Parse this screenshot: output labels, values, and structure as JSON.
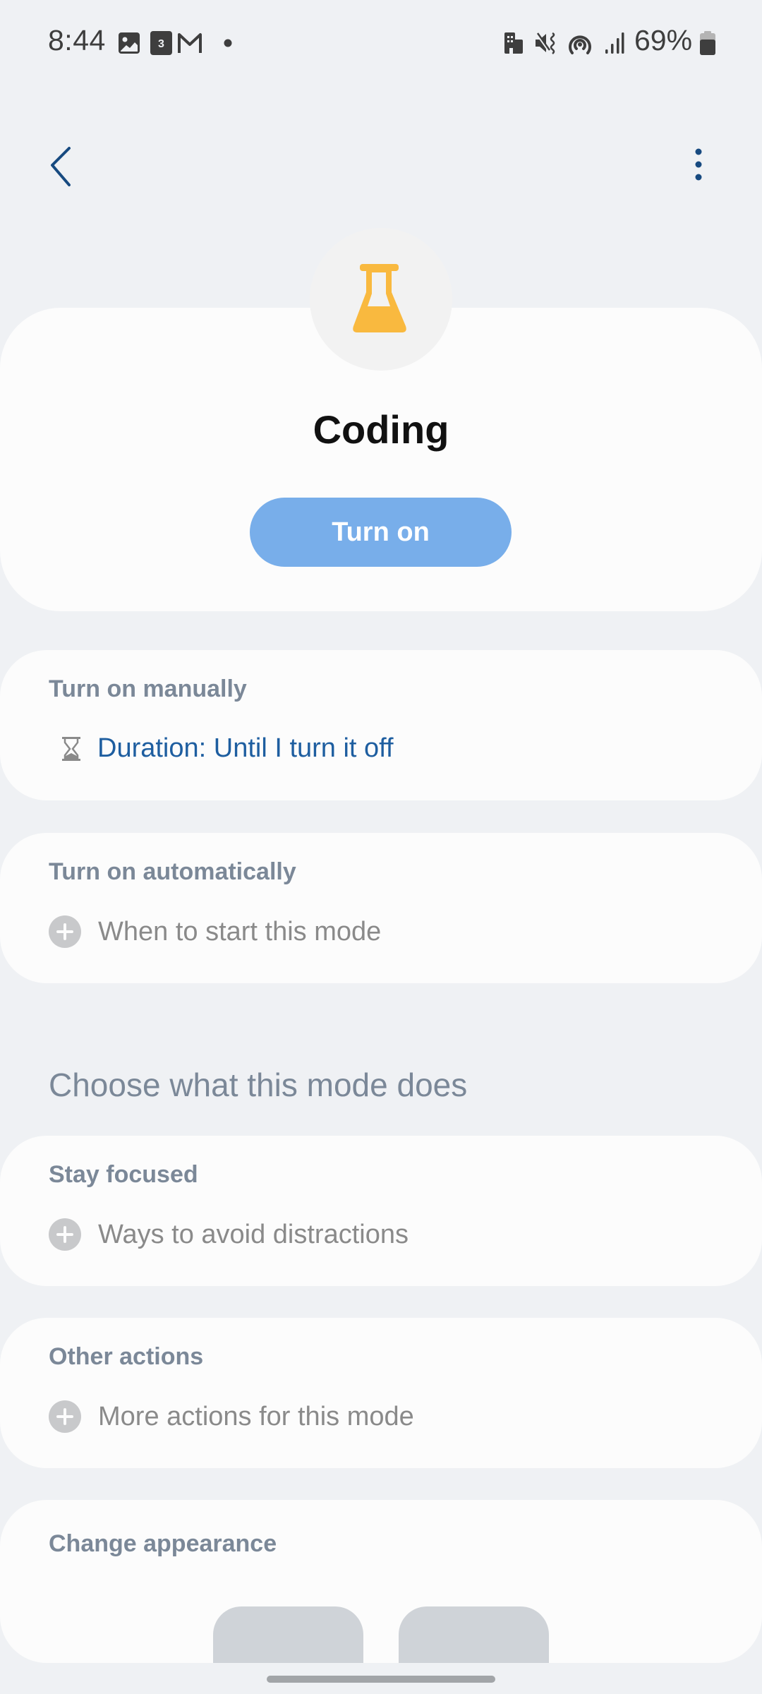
{
  "status_bar": {
    "time": "8:44",
    "left_icons": [
      "gallery-icon",
      "calendar-icon",
      "gmail-icon",
      "notification-dot-icon"
    ],
    "calendar_day": "3",
    "right_icons": [
      "work-profile-icon",
      "vibrate-mute-icon",
      "hotspot-icon",
      "signal-icon",
      "battery-icon"
    ],
    "battery_percent": "69%",
    "battery_level": 0.69
  },
  "app_bar": {
    "back_icon": "chevron-left-icon",
    "more_icon": "more-vertical-icon"
  },
  "mode": {
    "icon": "flask-icon",
    "icon_color": "#f9b93f",
    "name": "Coding",
    "turn_on_label": "Turn on",
    "accent_color": "#78aeea"
  },
  "sections": {
    "manual": {
      "title": "Turn on manually",
      "row_icon": "hourglass-icon",
      "row_label": "Duration: Until I turn it off"
    },
    "automatic": {
      "title": "Turn on automatically",
      "row_icon": "add-icon",
      "row_label": "When to start this mode"
    },
    "heading": "Choose what this mode does",
    "stay_focused": {
      "title": "Stay focused",
      "row_icon": "add-icon",
      "row_label": "Ways to avoid distractions"
    },
    "other_actions": {
      "title": "Other actions",
      "row_icon": "add-icon",
      "row_label": "More actions for this mode"
    },
    "appearance": {
      "title": "Change appearance"
    }
  }
}
